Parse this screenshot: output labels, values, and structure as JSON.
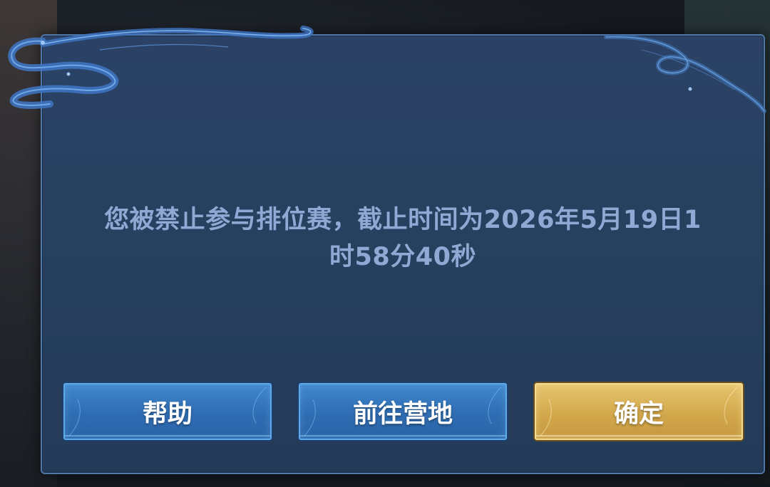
{
  "dialog": {
    "message_line1": "您被禁止参与排位赛，截止时间为2026年5月19日1",
    "message_line2": "时58分40秒"
  },
  "buttons": {
    "help_label": "帮助",
    "camp_label": "前往营地",
    "confirm_label": "确定"
  },
  "colors": {
    "dialog_bg": "#27405f",
    "dialog_border": "#4f77a8",
    "message_text": "#8fa9d4",
    "button_blue": "#2f6db3",
    "button_gold": "#d3a84c"
  }
}
